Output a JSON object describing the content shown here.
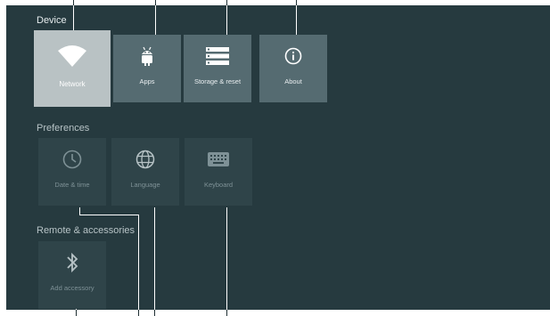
{
  "device": {
    "heading": "Device",
    "tiles": [
      {
        "label": "Network",
        "icon": "wifi-icon"
      },
      {
        "label": "Apps",
        "icon": "android-icon"
      },
      {
        "label": "Storage & reset",
        "icon": "storage-icon"
      },
      {
        "label": "About",
        "icon": "info-icon"
      }
    ]
  },
  "preferences": {
    "heading": "Preferences",
    "tiles": [
      {
        "label": "Date & time",
        "icon": "clock-icon"
      },
      {
        "label": "Language",
        "icon": "globe-icon"
      },
      {
        "label": "Keyboard",
        "icon": "keyboard-icon"
      }
    ]
  },
  "remote": {
    "heading": "Remote & accessories",
    "tiles": [
      {
        "label": "Add accessory",
        "icon": "bluetooth-icon"
      }
    ]
  },
  "colors": {
    "background": "#263a3f",
    "selected_tile": "#b9c2c4",
    "tile": "#556b71",
    "dim_tile": "#2f4449"
  }
}
